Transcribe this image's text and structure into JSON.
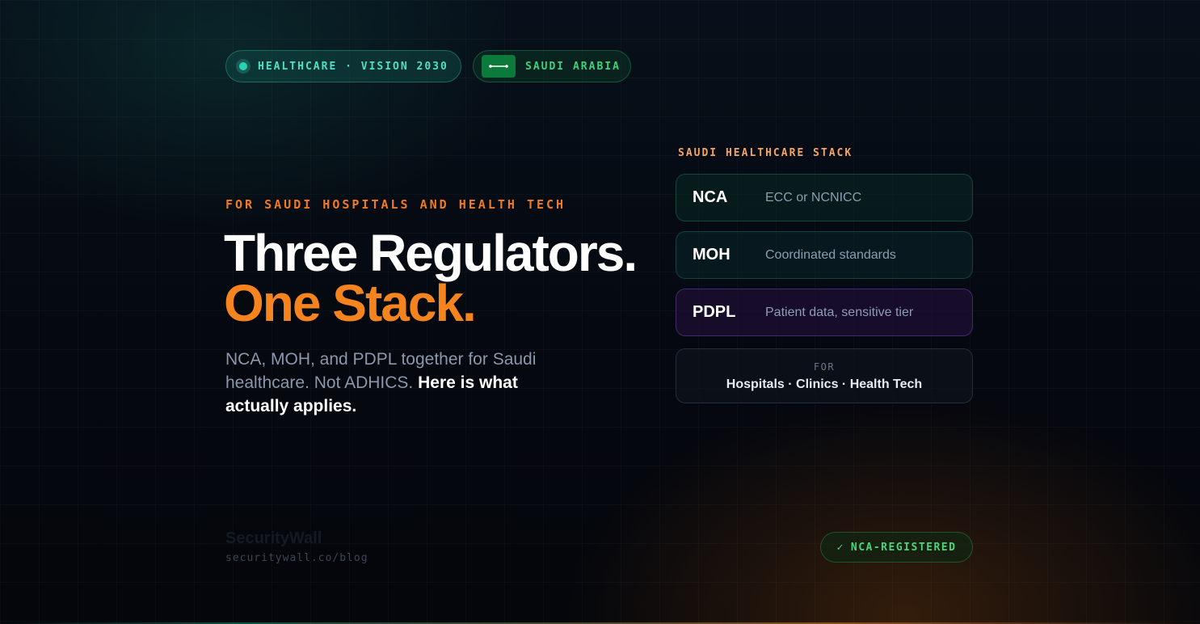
{
  "pills": {
    "primary": "HEALTHCARE · VISION 2030",
    "secondary": "SAUDI ARABIA"
  },
  "hero": {
    "kicker": "FOR SAUDI HOSPITALS AND HEALTH TECH",
    "headline_line1": "Three Regulators.",
    "headline_line2": "One Stack.",
    "lede_plain": "NCA, MOH, and PDPL together for Saudi healthcare. Not ADHICS.",
    "lede_bold": "Here is what actually applies."
  },
  "stack": {
    "label": "SAUDI HEALTHCARE STACK",
    "items": [
      {
        "code": "NCA",
        "desc": "ECC or NCNICC"
      },
      {
        "code": "MOH",
        "desc": "Coordinated standards"
      },
      {
        "code": "PDPL",
        "desc": "Patient data, sensitive tier"
      }
    ],
    "for_label": "FOR",
    "for_list": "Hospitals · Clinics · Health Tech"
  },
  "footer": {
    "brand": "SecurityWall",
    "url": "securitywall.co/blog",
    "badge": "NCA-REGISTERED",
    "badge_check": "✓"
  },
  "colors": {
    "accent_orange": "#f5841f",
    "accent_teal": "#27d3b3",
    "accent_green": "#4cd37a"
  }
}
